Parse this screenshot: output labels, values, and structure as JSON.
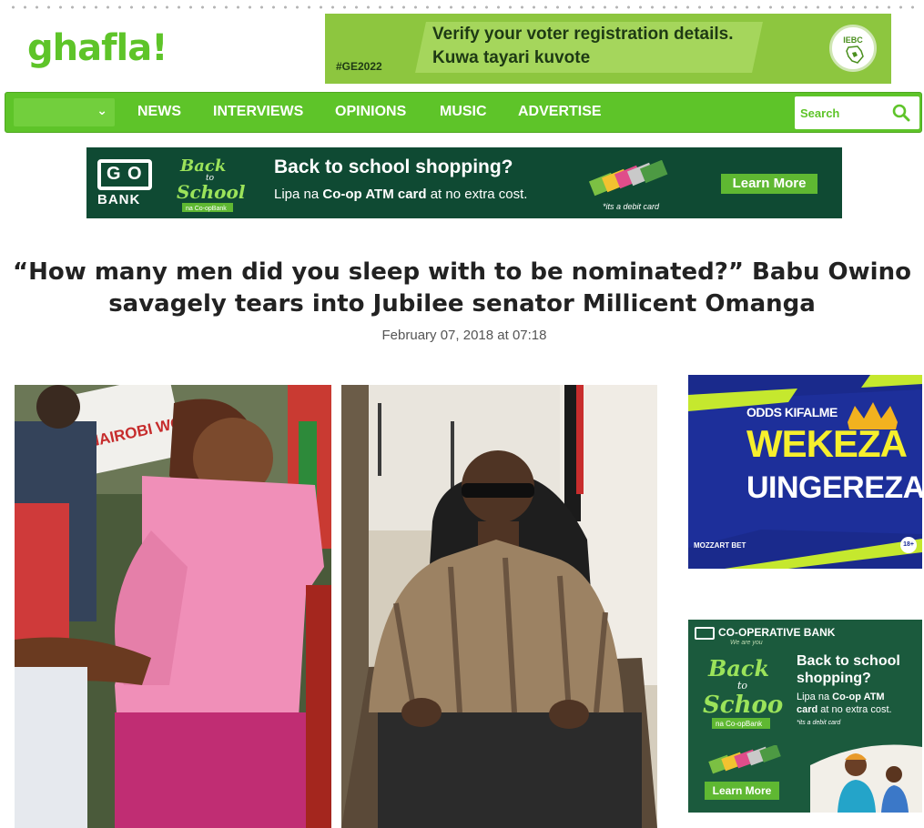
{
  "site": {
    "logo_text": "ghafla!"
  },
  "top_ad": {
    "line1": "Verify your voter registration details.",
    "line2": "Kuwa tayari kuvote",
    "hashtag": "#GE2022",
    "seal_text": "IEBC"
  },
  "nav": {
    "select_value": "",
    "items": [
      "NEWS",
      "INTERVIEWS",
      "OPINIONS",
      "MUSIC",
      "ADVERTISE"
    ],
    "search_placeholder": "Search"
  },
  "coop_banner": {
    "bank_word": "BANK",
    "headline": "Back to school shopping?",
    "sub_prefix": "Lipa na ",
    "sub_bold": "Co-op ATM card",
    "sub_suffix": " at no extra cost.",
    "debit_note": "*its a debit card",
    "cta": "Learn More",
    "bts_line1": "Back",
    "bts_line2": "to",
    "bts_line3": "School",
    "bts_line4": "na Co-opBank"
  },
  "article": {
    "title": "“How many men did you sleep with to be nominated?” Babu Owino savagely tears into Jubilee senator Millicent Omanga",
    "date": "February 07, 2018 at 07:18"
  },
  "side_ad_mozzart": {
    "odds": "ODDS KIFALME",
    "wekeza": "WEKEZA",
    "uingereza": "UINGEREZA",
    "brand": "MOZZART BET",
    "age": "18+"
  },
  "side_ad_coop": {
    "brand": "CO-OPERATIVE BANK",
    "tagline": "We are you",
    "headline_1": "Back to school",
    "headline_2": "shopping?",
    "text_1": "Lipa na ",
    "text_bold": "Co-op ATM",
    "text_2": "card",
    "text_3": " at no extra cost.",
    "debit_note": "*its a debit card",
    "cta": "Learn More",
    "bts_line1": "Back",
    "bts_line2": "to",
    "bts_line3": "School",
    "bts_line4": "na Co-opBank"
  },
  "colors": {
    "brand_green": "#5ec429",
    "coop_green": "#0f4a33",
    "mozzart_blue": "#1d2f9a",
    "mozzart_yellow": "#f6ef2d"
  }
}
